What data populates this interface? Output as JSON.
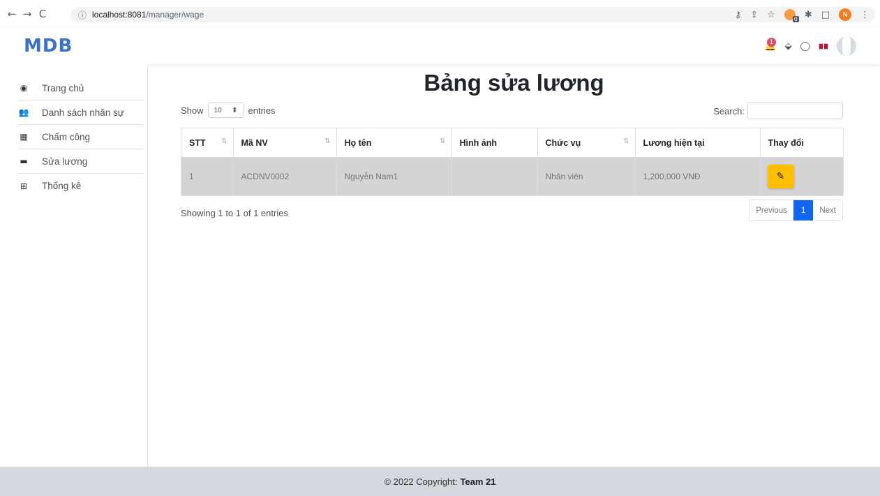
{
  "browser": {
    "back_glyph": "←",
    "forward_glyph": "→",
    "reload_glyph": "C",
    "url_host": "localhost:8081",
    "url_path": "/manager/wage",
    "profile_initial": "N"
  },
  "header": {
    "logo": "MDB",
    "notification_count": "1"
  },
  "sidebar": {
    "items": [
      {
        "label": "Trang chủ",
        "icon": "dashboard-icon",
        "glyph": "◉"
      },
      {
        "label": "Danh sách nhân sự",
        "icon": "users-icon",
        "glyph": "👥"
      },
      {
        "label": "Chấm công",
        "icon": "calendar-icon",
        "glyph": "▦"
      },
      {
        "label": "Sửa lương",
        "icon": "money-bill-icon",
        "glyph": "▬"
      },
      {
        "label": "Thống kê",
        "icon": "table-icon",
        "glyph": "⊞"
      }
    ]
  },
  "main": {
    "title": "Bảng sửa lương",
    "show_label": "Show",
    "entries_label": "entries",
    "page_length": "10",
    "search_label": "Search:",
    "columns": [
      "STT",
      "Mã NV",
      "Họ tên",
      "Hình ảnh",
      "Chức vụ",
      "Lương hiện tại",
      "Thay đổi"
    ],
    "rows": [
      {
        "stt": "1",
        "ma_nv": "ACDNV0002",
        "ho_ten": "Nguyễn Nam1",
        "hinh_anh": "",
        "chuc_vu": "Nhân viên",
        "luong": "1,200,000 VNĐ"
      }
    ],
    "info": "Showing 1 to 1 of 1 entries",
    "pagination": {
      "previous": "Previous",
      "current": "1",
      "next": "Next"
    }
  },
  "footer": {
    "copyright": "© 2022 Copyright:",
    "team": "Team 21"
  },
  "colors": {
    "accent": "#1266f1",
    "edit_button": "#ffbf00",
    "row_highlight": "#d4d4d4",
    "footer": "#d5d8de"
  }
}
